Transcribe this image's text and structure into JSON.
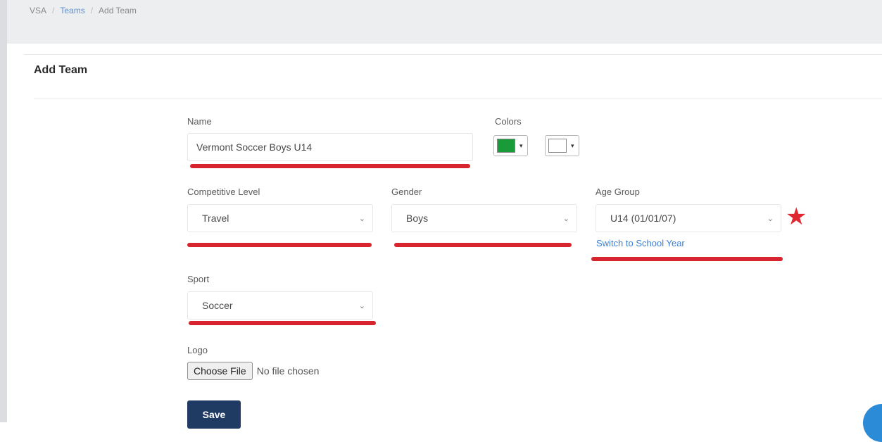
{
  "breadcrumb": {
    "items": [
      "VSA",
      "Teams",
      "Add Team"
    ],
    "separator": "/"
  },
  "page": {
    "title": "Add Team"
  },
  "form": {
    "name": {
      "label": "Name",
      "value": "Vermont Soccer Boys U14"
    },
    "colors": {
      "label": "Colors",
      "primary": "#1a9b3a",
      "secondary": "#ffffff",
      "caret": "▾"
    },
    "competitive_level": {
      "label": "Competitive Level",
      "value": "Travel"
    },
    "gender": {
      "label": "Gender",
      "value": "Boys"
    },
    "age_group": {
      "label": "Age Group",
      "value": "U14 (01/01/07)",
      "switch_link": "Switch to School Year"
    },
    "sport": {
      "label": "Sport",
      "value": "Soccer"
    },
    "logo": {
      "label": "Logo",
      "button": "Choose File",
      "status": "No file chosen"
    },
    "save_label": "Save"
  },
  "annotations": {
    "highlight_color": "#d8242e",
    "star": "★"
  },
  "icons": {
    "chevron": "⌄"
  }
}
